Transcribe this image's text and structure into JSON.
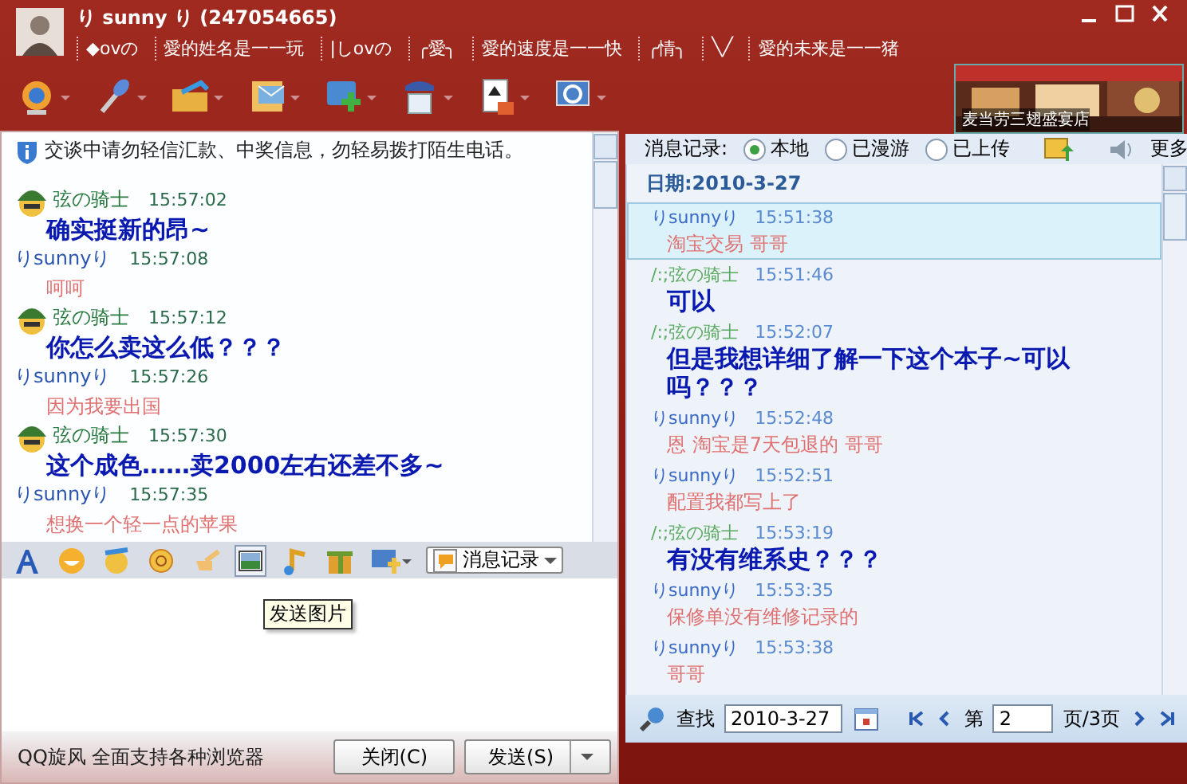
{
  "window": {
    "title": "り sunny り (247054665)",
    "signature": [
      "◆ovの",
      "愛的姓名是一一玩",
      "|しovの",
      "╭愛╮",
      "愛的速度是一一快",
      "╭情╮",
      "╲╱",
      "愛的未来是一一猪"
    ]
  },
  "ad": {
    "kind": "picture",
    "caption": "麦当劳三翅盛宴店"
  },
  "chat": {
    "notice": "交谈中请勿轻信汇款、中奖信息，勿轻易拨打陌生电话。",
    "messages": [
      {
        "kind": "peer",
        "sender": "弦の骑士",
        "time": "15:57:02",
        "text": "确实挺新的昂~"
      },
      {
        "kind": "self",
        "sender": "りsunnyり",
        "time": "15:57:08",
        "text": "呵呵"
      },
      {
        "kind": "peer",
        "sender": "弦の骑士",
        "time": "15:57:12",
        "text": "你怎么卖这么低？？？"
      },
      {
        "kind": "self",
        "sender": "りsunnyり",
        "time": "15:57:26",
        "text": "因为我要出国"
      },
      {
        "kind": "peer",
        "sender": "弦の骑士",
        "time": "15:57:30",
        "text": "这个成色……卖2000左右还差不多~"
      },
      {
        "kind": "self",
        "sender": "りsunnyり",
        "time": "15:57:35",
        "text": "想换一个轻一点的苹果"
      }
    ]
  },
  "chat_toolbar": {
    "history_button": "消息记录",
    "tooltip": "发送图片"
  },
  "status_text": "QQ旋风 全面支持各种浏览器",
  "buttons": [
    "关闭(C)",
    "发送(S)"
  ],
  "history": {
    "label": "消息记录:",
    "sources": [
      {
        "label": "本地",
        "selected": true
      },
      {
        "label": "已漫游",
        "selected": false
      },
      {
        "label": "已上传",
        "selected": false
      }
    ],
    "more": "更多",
    "date_heading": "日期:2010-3-27",
    "entries": [
      {
        "kind": "self",
        "sender": "りsunnyり",
        "time": "15:51:38",
        "text": "淘宝交易 哥哥",
        "selected": true
      },
      {
        "kind": "peer",
        "sender": "/:;弦の骑士",
        "time": "15:51:46",
        "text": "可以",
        "selected": false
      },
      {
        "kind": "peer",
        "sender": "/:;弦の骑士",
        "time": "15:52:07",
        "text": "但是我想详细了解一下这个本子~可以吗？？？",
        "selected": false
      },
      {
        "kind": "self",
        "sender": "りsunnyり",
        "time": "15:52:48",
        "text": "恩 淘宝是7天包退的 哥哥",
        "selected": false
      },
      {
        "kind": "self",
        "sender": "りsunnyり",
        "time": "15:52:51",
        "text": "配置我都写上了",
        "selected": false
      },
      {
        "kind": "peer",
        "sender": "/:;弦の骑士",
        "time": "15:53:19",
        "text": "有没有维系史？？？",
        "selected": false
      },
      {
        "kind": "self",
        "sender": "りsunnyり",
        "time": "15:53:35",
        "text": "保修单没有维修记录的",
        "selected": false
      },
      {
        "kind": "self",
        "sender": "りsunnyり",
        "time": "15:53:38",
        "text": "哥哥",
        "selected": false
      }
    ],
    "search": {
      "label": "查找",
      "date": "2010-3-27",
      "page_prefix": "第",
      "page": "2",
      "page_suffix": "页/3页"
    }
  }
}
